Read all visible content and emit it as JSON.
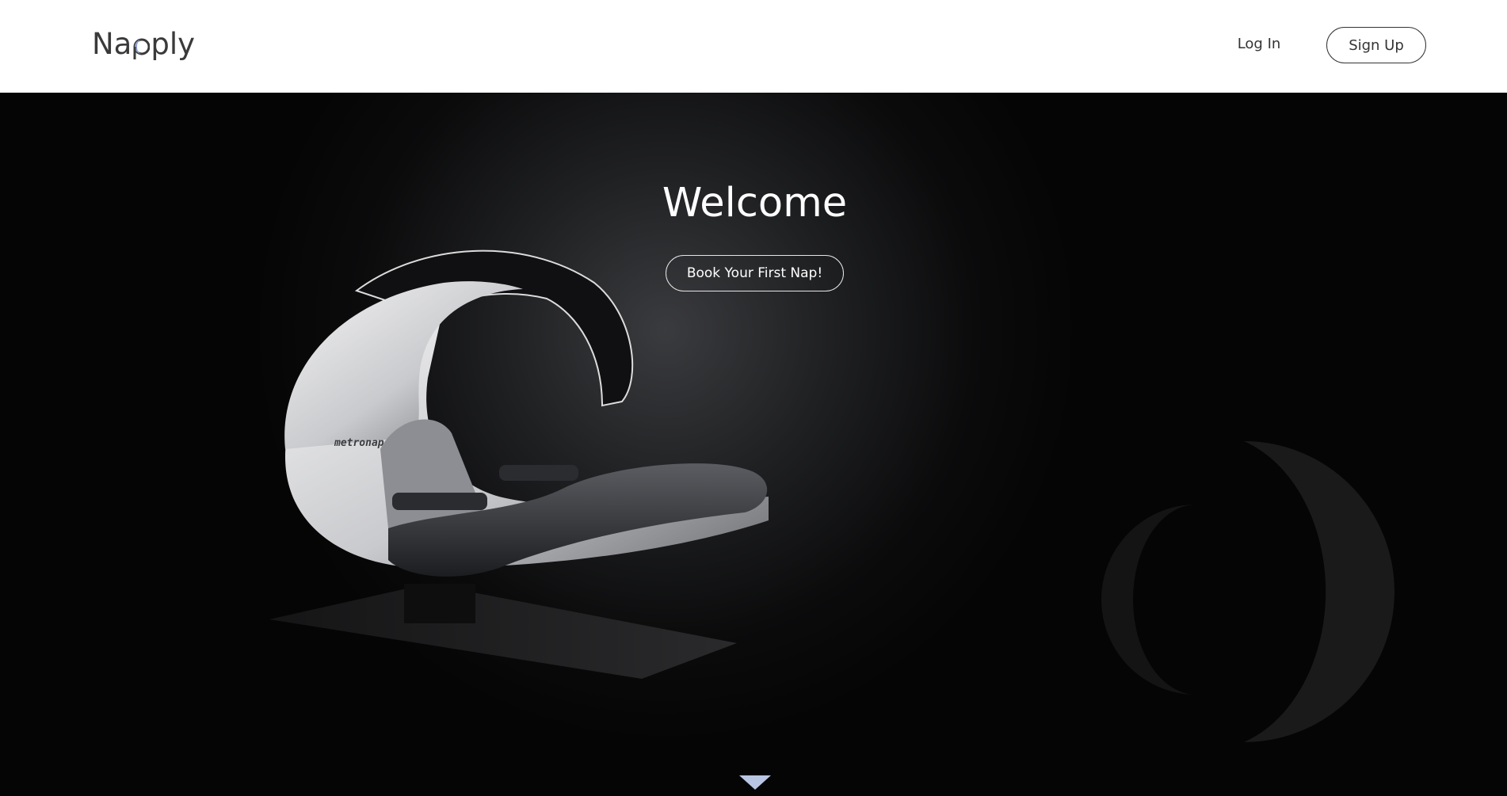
{
  "header": {
    "logo_text_before": "Na",
    "logo_text_after": "ply",
    "login_label": "Log In",
    "signup_label": "Sign Up"
  },
  "hero": {
    "title": "Welcome",
    "cta_label": "Book Your First Nap!",
    "pod_brand_text": "metronaps"
  },
  "colors": {
    "header_bg": "#ffffff",
    "hero_bg": "#050505",
    "text_light": "#ffffff",
    "text_dark": "#333333",
    "scroll_arrow": "#b9c6e3"
  },
  "icons": {
    "logo_mark": "moon-crescent-icon",
    "scroll": "chevron-down-icon",
    "decoration": "crescent-moon-icon"
  }
}
